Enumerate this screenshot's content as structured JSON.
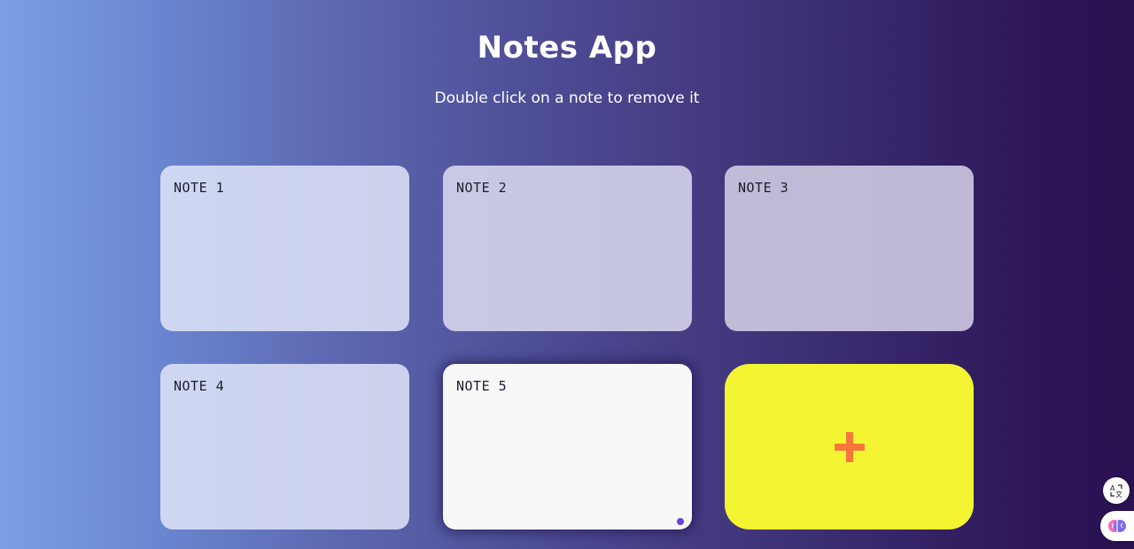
{
  "header": {
    "title": "Notes App",
    "subtitle": "Double click on a note to remove it"
  },
  "notes": [
    {
      "label": "NOTE 1"
    },
    {
      "label": "NOTE 2"
    },
    {
      "label": "NOTE 3"
    },
    {
      "label": "NOTE 4"
    },
    {
      "label": "NOTE 5"
    }
  ],
  "add_button": {
    "icon": "plus-icon"
  },
  "floating": {
    "translate_icon": "translate-icon",
    "assistant_icon": "brain-icon"
  },
  "colors": {
    "add_button": "#f3f532",
    "plus": "#f9763a",
    "accent_dot": "#6b3fe0"
  }
}
